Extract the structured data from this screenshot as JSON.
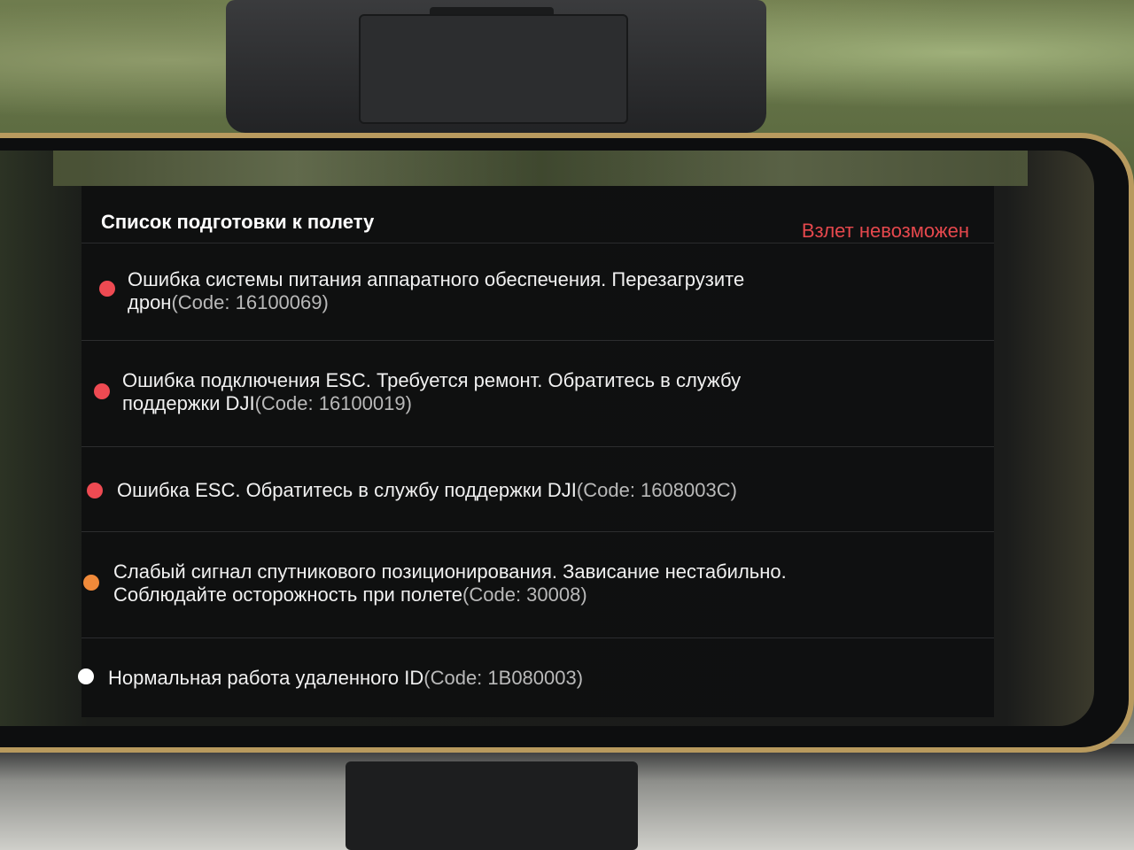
{
  "preflight": {
    "title": "Список подготовки к полету",
    "status": "Взлет невозможен",
    "items": [
      {
        "severity": "error",
        "color": "#ee4a52",
        "text_line1": "Ошибка системы питания аппаратного обеспечения. Перезагрузите",
        "text_line2": "дрон",
        "code": "(Code: 16100069)"
      },
      {
        "severity": "error",
        "color": "#ee4a52",
        "text_line1": "Ошибка подключения ESC. Требуется ремонт. Обратитесь в службу",
        "text_line2": "поддержки DJI",
        "code": "(Code: 16100019)"
      },
      {
        "severity": "error",
        "color": "#ee4a52",
        "text_line1": "Ошибка ESC. Обратитесь в службу поддержки DJI",
        "text_line2": "",
        "code": "(Code: 1608003C)"
      },
      {
        "severity": "warning",
        "color": "#f08a3a",
        "text_line1": "Слабый сигнал спутникового позиционирования. Зависание нестабильно.",
        "text_line2": "Соблюдайте осторожность при полете",
        "code": "(Code: 30008)"
      },
      {
        "severity": "normal",
        "color": "#ffffff",
        "text_line1": "Нормальная работа удаленного ID",
        "text_line2": "",
        "code": "(Code: 1B080003)"
      }
    ]
  }
}
